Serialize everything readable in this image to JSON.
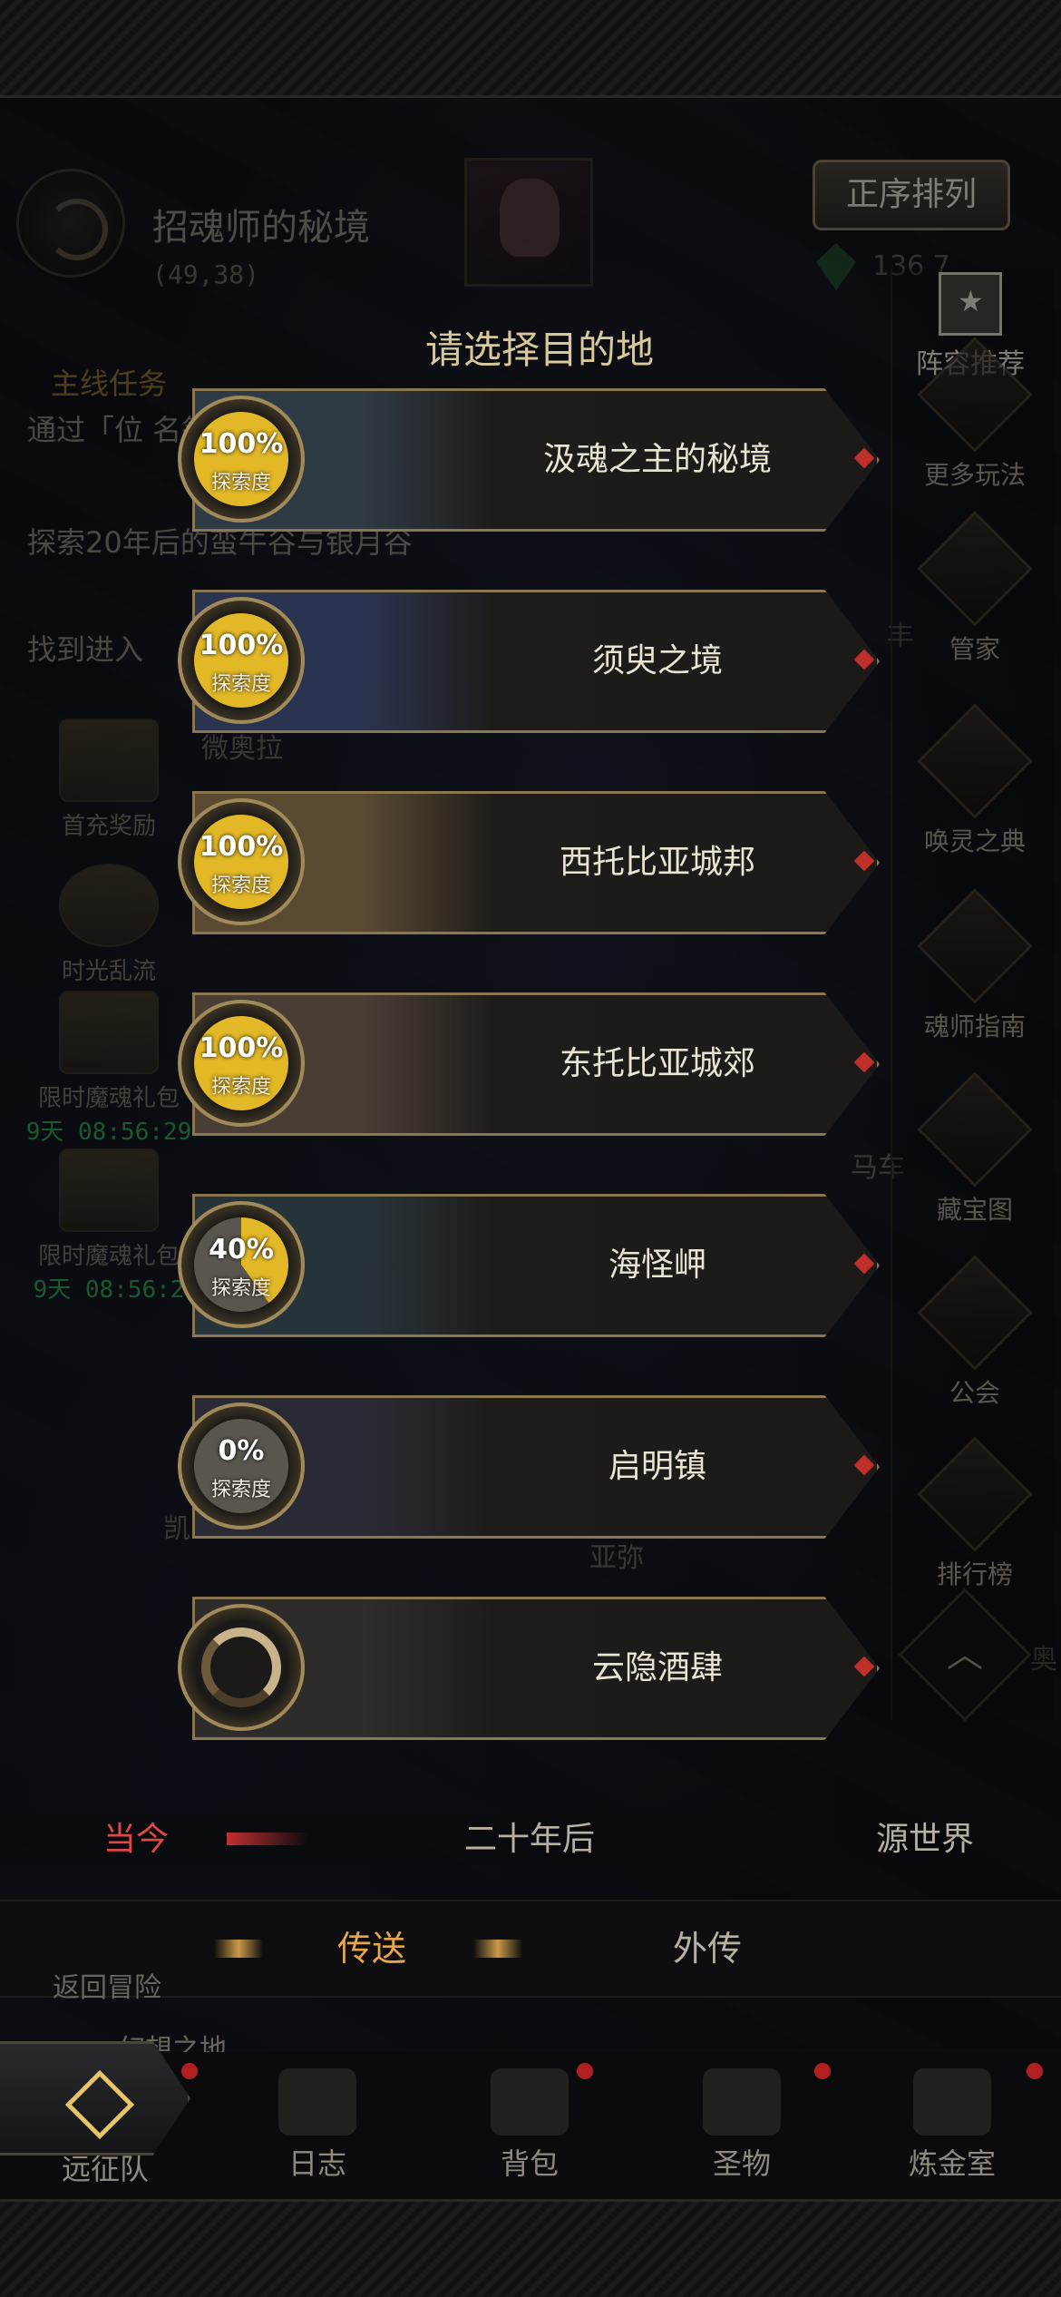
{
  "realm": {
    "name": "招魂师的秘境",
    "coords": "(49,38)"
  },
  "sort_button": "正序排列",
  "currency": {
    "count": "136 7"
  },
  "modal": {
    "title": "请选择目的地"
  },
  "destinations": [
    {
      "name": "汲魂之主的秘境",
      "progress": "100%",
      "progress_value": 100,
      "label": "探索度",
      "has_progress": true,
      "art_color": "#2e3a44"
    },
    {
      "name": "须臾之境",
      "progress": "100%",
      "progress_value": 100,
      "label": "探索度",
      "has_progress": true,
      "art_color": "#2a3450"
    },
    {
      "name": "西托比亚城邦",
      "progress": "100%",
      "progress_value": 100,
      "label": "探索度",
      "has_progress": true,
      "art_color": "#5a4a32"
    },
    {
      "name": "东托比亚城郊",
      "progress": "100%",
      "progress_value": 100,
      "label": "探索度",
      "has_progress": true,
      "art_color": "#4a3e34"
    },
    {
      "name": "海怪岬",
      "progress": "40%",
      "progress_value": 40,
      "label": "探索度",
      "has_progress": true,
      "art_color": "#26343a"
    },
    {
      "name": "启明镇",
      "progress": "0%",
      "progress_value": 0,
      "label": "探索度",
      "has_progress": true,
      "art_color": "#2a2a34"
    },
    {
      "name": "云隐酒肆",
      "progress": "",
      "progress_value": 0,
      "label": "",
      "has_progress": false,
      "art_color": "#2e2c2a"
    }
  ],
  "era_tabs": {
    "current": "当今",
    "twenty_years": "二十年后",
    "origin": "源世界"
  },
  "sub_tabs": {
    "teleport": "传送",
    "side_story": "外传"
  },
  "quests": {
    "title": "主线任务",
    "items": [
      "通过「位 名祭坛远",
      "探索20年后的蛮牛谷与银月谷",
      "找到进入"
    ]
  },
  "left_menu": [
    {
      "label": "首充奖励",
      "timer": ""
    },
    {
      "label": "时光乱流",
      "timer": ""
    },
    {
      "label": "限时魔魂礼包",
      "timer": "9天 08:56:29"
    },
    {
      "label": "限时魔魂礼包",
      "timer": "9天 08:56:2"
    }
  ],
  "right_menu": {
    "lineup": "阵容推荐",
    "items": [
      "更多玩法",
      "管家",
      "唤灵之典",
      "魂师指南",
      "藏宝图",
      "公会",
      "排行榜"
    ]
  },
  "map_labels": {
    "a": "微奥拉",
    "b": "马车",
    "c": "凯",
    "d": "亚弥",
    "e": "丰",
    "f": "奥",
    "return": "返回冒险",
    "dream": "幻想之地"
  },
  "bottom_nav": [
    "远征队",
    "日志",
    "背包",
    "圣物",
    "炼金室"
  ],
  "colors": {
    "gold": "#8a7650",
    "active_tab": "#e04848",
    "active_subtab": "#e8a64a",
    "timer": "#2fa05a"
  }
}
